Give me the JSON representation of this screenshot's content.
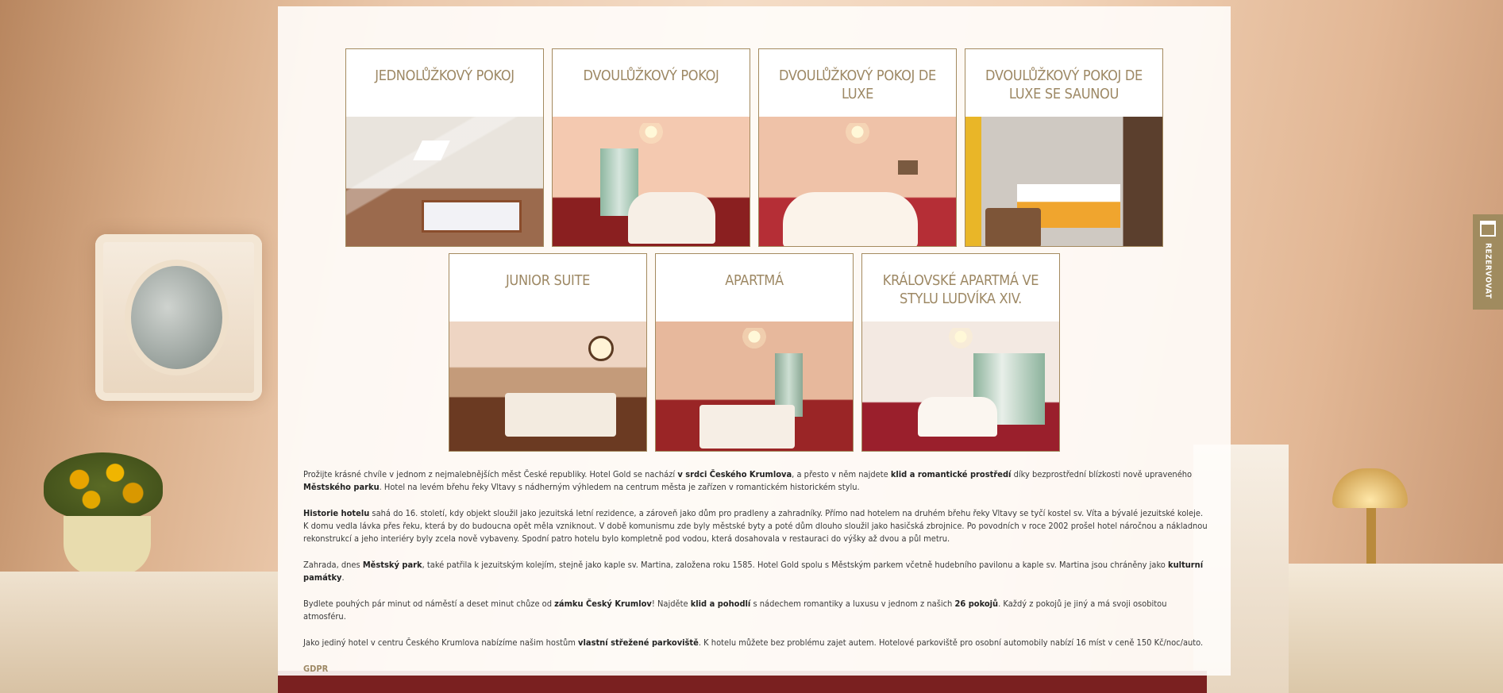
{
  "rooms_row1": [
    {
      "title": "JEDNOLŮŽKOVÝ POKOJ",
      "photo": "single-room-photo"
    },
    {
      "title": "DVOULŮŽKOVÝ POKOJ",
      "photo": "double-room-photo"
    },
    {
      "title": "DVOULŮŽKOVÝ POKOJ DE LUXE",
      "photo": "double-deluxe-photo"
    },
    {
      "title": "DVOULŮŽKOVÝ POKOJ DE LUXE SE SAUNOU",
      "photo": "double-deluxe-sauna-photo"
    }
  ],
  "rooms_row2": [
    {
      "title": "JUNIOR SUITE",
      "photo": "junior-suite-photo"
    },
    {
      "title": "APARTMÁ",
      "photo": "apartment-photo"
    },
    {
      "title": "KRÁLOVSKÉ APARTMÁ VE STYLU LUDVÍKA XIV.",
      "photo": "royal-apartment-photo"
    }
  ],
  "paragraphs": {
    "p1": {
      "a": "Prožijte krásné chvíle v jednom z nejmalebnějších měst České republiky. Hotel Gold se nachází ",
      "b1": "v srdci Českého Krumlova",
      "c": ", a přesto v něm najdete ",
      "b2": "klid a romantické prostředí",
      "d": " díky bezprostřední blízkosti nově upraveného ",
      "b3": "Městského parku",
      "e": ". Hotel na levém břehu řeky Vltavy s nádherným výhledem na centrum města je zařízen v romantickém historickém stylu."
    },
    "p2": {
      "b1": "Historie hotelu",
      "a": " sahá do 16. století, kdy objekt sloužil jako jezuitská letní rezidence, a zároveň jako dům pro pradleny a zahradníky. Přímo nad hotelem na druhém břehu řeky Vltavy se tyčí kostel sv. Víta a bývalé jezuitské koleje. K domu vedla lávka přes řeku, která by do budoucna opět měla vzniknout. V době komunismu zde byly městské byty a poté dům dlouho sloužil jako hasičská zbrojnice. Po povodních v roce 2002 prošel hotel náročnou a nákladnou rekonstrukcí a jeho interiéry byly zcela nově vybaveny. Spodní patro hotelu bylo kompletně pod vodou, která dosahovala v restauraci do výšky až dvou a půl metru."
    },
    "p3": {
      "a": "Zahrada, dnes ",
      "b1": "Městský park",
      "c": ", také patřila k jezuitským kolejím, stejně jako kaple sv. Martina, založena roku 1585. Hotel Gold spolu s Městským parkem včetně hudebního pavilonu a kaple sv. Martina jsou chráněny jako ",
      "b2": "kulturní památky",
      "d": "."
    },
    "p4": {
      "a": "Bydlete pouhých pár minut od náměstí a deset minut chůze od ",
      "b1": "zámku Český Krumlov",
      "c": "! Najděte ",
      "b2": "klid a pohodlí",
      "d": " s nádechem romantiky a luxusu v jednom z našich ",
      "b3": "26 pokojů",
      "e": ". Každý z pokojů je jiný a má svoji osobitou atmosféru."
    },
    "p5": {
      "a": "Jako jediný hotel v centru Českého Krumlova nabízíme našim hostům ",
      "b1": "vlastní střežené parkoviště",
      "c": ". K hotelu můžete bez problému zajet autem. Hotelové parkoviště pro osobní automobily nabízí 16 míst v ceně 150 Kč/noc/auto."
    }
  },
  "gdpr_link": "GDPR",
  "reserve_tab": {
    "label": "REZERVOVAT",
    "icon": "calendar-icon"
  },
  "colors": {
    "accent": "#9d8864",
    "border": "#a48a5f",
    "reserve_bg": "#a08b5f"
  }
}
